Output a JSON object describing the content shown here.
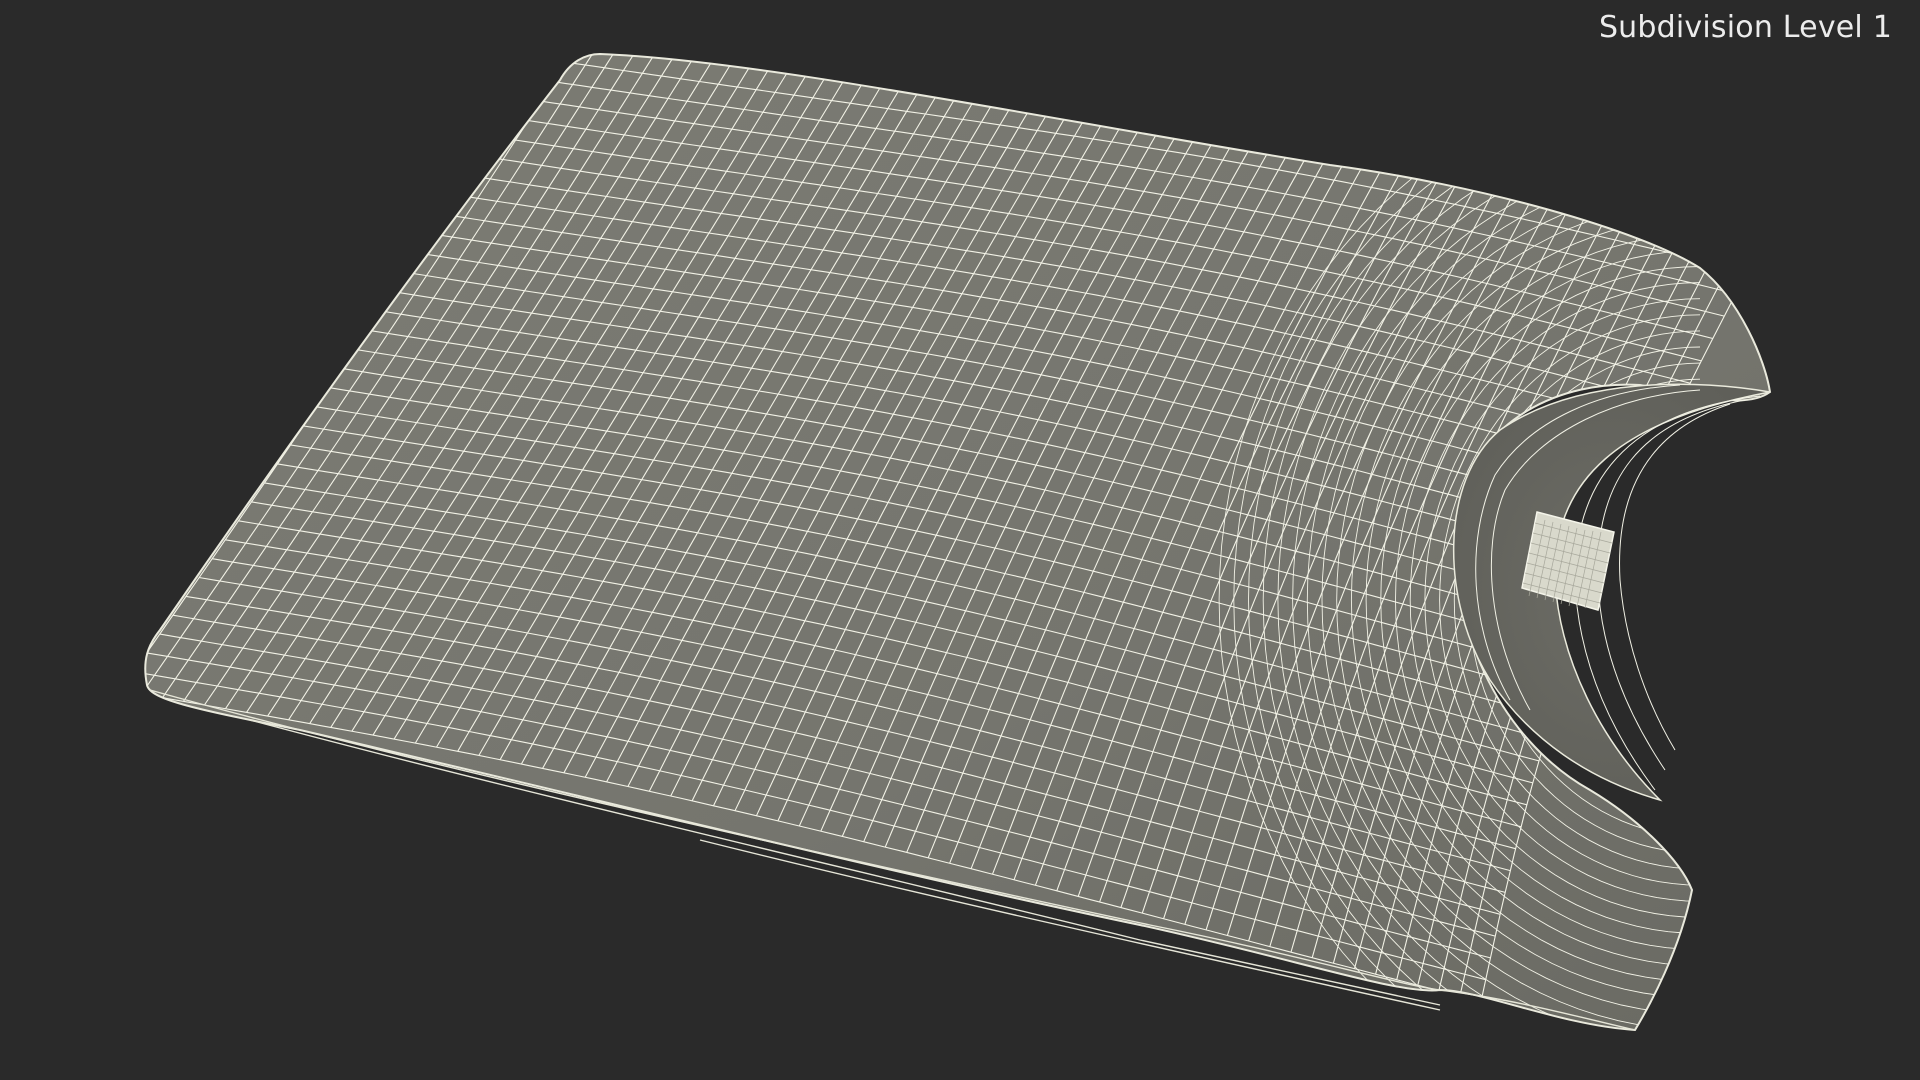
{
  "viewport": {
    "label": "Subdivision Level 1",
    "background_color": "#2a2a2a",
    "label_color": "#ececec"
  },
  "model": {
    "surface_color": "#777770",
    "surface_shadow_color": "#5e5e58",
    "wire_color": "#f2f2e6",
    "tag_color": "#d9d9cc"
  }
}
